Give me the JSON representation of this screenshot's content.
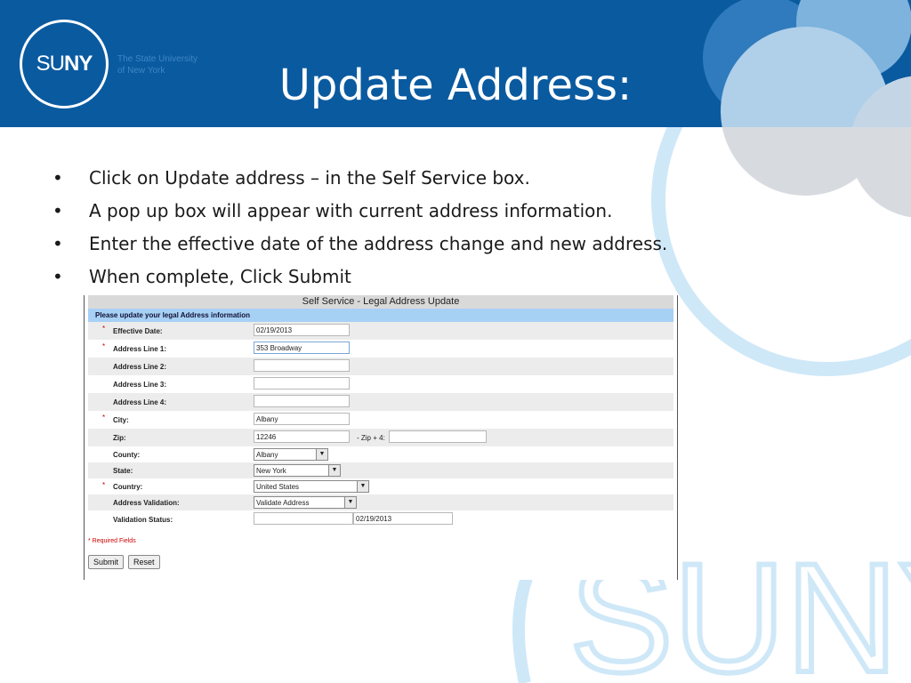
{
  "header": {
    "logo_prefix": "SU",
    "logo_suffix": "NY",
    "tagline_line1": "The State University",
    "tagline_line2": "of New York",
    "title": "Update Address:"
  },
  "bullets": [
    "Click on Update address –  in the Self Service box.",
    "A pop up box will appear with current address information.",
    "Enter the effective date of the address change and new address.",
    "When complete, Click Submit"
  ],
  "bullet_symbol": "•",
  "form": {
    "title": "Self Service - Legal Address Update",
    "subheader": "Please update your legal Address information",
    "required_marker": "*",
    "fields": {
      "effective_date": {
        "label": "Effective Date:",
        "value": "02/19/2013"
      },
      "address1": {
        "label": "Address Line 1:",
        "value": "353 Broadway"
      },
      "address2": {
        "label": "Address Line 2:",
        "value": ""
      },
      "address3": {
        "label": "Address Line 3:",
        "value": ""
      },
      "address4": {
        "label": "Address Line 4:",
        "value": ""
      },
      "city": {
        "label": "City:",
        "value": "Albany"
      },
      "zip": {
        "label": "Zip:",
        "value": "12246",
        "plus4_label": "- Zip + 4:",
        "plus4_value": ""
      },
      "county": {
        "label": "County:",
        "value": "Albany"
      },
      "state": {
        "label": "State:",
        "value": "New York"
      },
      "country": {
        "label": "Country:",
        "value": "United States"
      },
      "validation": {
        "label": "Address Validation:",
        "value": "Validate Address"
      },
      "validation_status": {
        "label": "Validation Status:",
        "value": "",
        "date": "02/19/2013"
      }
    },
    "footnote": "* Required Fields",
    "submit_label": "Submit",
    "reset_label": "Reset",
    "dropdown_arrow": "▼"
  },
  "watermark_text": "SUNY",
  "colors": {
    "header_blue": "#0a5aa0",
    "light_blue": "#cfe8f8",
    "required_red": "#cc0000",
    "subheader_blue": "#a7d0f5"
  }
}
